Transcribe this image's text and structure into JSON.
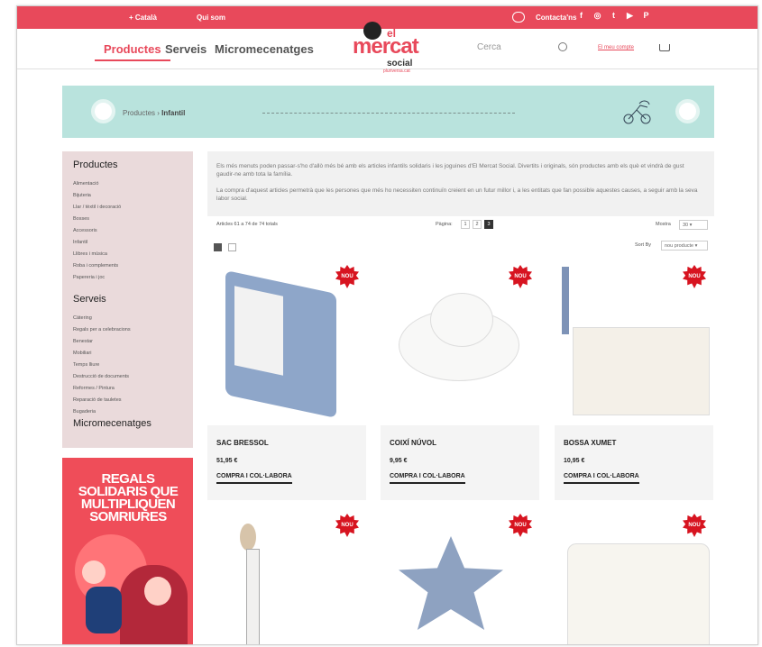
{
  "topbar": {
    "language": "+ Català",
    "about": "Qui som",
    "contact": "Contacta'ns",
    "social": [
      "f",
      "◎",
      "t",
      "▶",
      "P"
    ]
  },
  "nav": {
    "products": "Productes",
    "services": "Serveis",
    "micro": "Micromecenatges"
  },
  "logo": {
    "el": "el",
    "mercat": "mercat",
    "social": "social",
    "sub": "pluriversa.cat"
  },
  "search": {
    "placeholder": "Cerca",
    "account": "El meu compte"
  },
  "breadcrumb": {
    "root": "Productes",
    "current": "Infantil"
  },
  "sidebar": {
    "title": "Productes",
    "items": [
      "Alimentació",
      "Bijuteria",
      "Llar / tèxtil i decoració",
      "Bosses",
      "Accessoris",
      "Infantil",
      "Llibres i música",
      "Roba i complements",
      "Papereria i joc"
    ],
    "services_title": "Serveis",
    "services": [
      "Càtering",
      "Regals per a celebracions",
      "Benestar",
      "Mobiliari",
      "Temps lliure",
      "Destrucció de documents",
      "Reformes / Pintura",
      "Reparació de tauletes",
      "Bugaderia"
    ],
    "micro": "Micromecenatges"
  },
  "promo": {
    "text": "REGALS SOLIDARIS QUE MULTIPLIQUEN SOMRIURES"
  },
  "intro": {
    "p1": "Els més menuts poden passar-s'ho d'allò més bé amb els articles infantils solidaris i les joguines d'El Mercat Social. Divertits i originals, són productes amb els què et vindrà de gust gaudir-ne amb tota la família.",
    "p2": "La compra d'aquest articles permetrà que les persones que més ho necessiten continuïn creient en un futur millor i, a les entitats que fan possible aquestes causes, a seguir amb la seva labor social."
  },
  "toolbar": {
    "count": "Articles 61 a 74 de 74 totals",
    "page_label": "Pàgina:",
    "pages": [
      "1",
      "2",
      "3"
    ],
    "show_label": "Mostra",
    "show_value": "30",
    "sort_label": "Sort By",
    "sort_value": "nou producte"
  },
  "products": [
    {
      "name": "SAC BRESSOL",
      "price": "51,95 €",
      "button": "COMPRA I COL·LABORA",
      "badge": "NOU"
    },
    {
      "name": "COIXÍ NÚVOL",
      "price": "9,95 €",
      "button": "COMPRA I COL·LABORA",
      "badge": "NOU"
    },
    {
      "name": "BOSSA XUMET",
      "price": "10,95 €",
      "button": "COMPRA I COL·LABORA",
      "badge": "NOU"
    },
    {
      "name": "",
      "price": "",
      "button": "",
      "badge": "NOU"
    },
    {
      "name": "",
      "price": "",
      "button": "",
      "badge": "NOU"
    },
    {
      "name": "",
      "price": "",
      "button": "",
      "badge": "NOU"
    }
  ]
}
